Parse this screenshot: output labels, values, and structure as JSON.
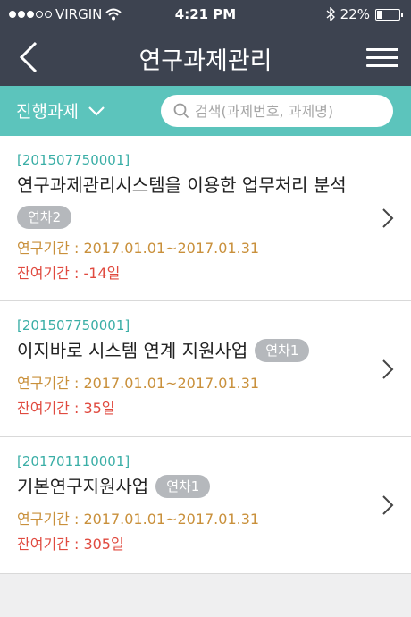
{
  "status_bar": {
    "carrier": "VIRGIN",
    "time": "4:21 PM",
    "battery_text": "22%",
    "battery_level": 0.22
  },
  "header": {
    "title": "연구과제관리"
  },
  "filter": {
    "selected": "진행과제",
    "search_placeholder": "검색(과제번호, 과제명)"
  },
  "items": [
    {
      "id": "[201507750001]",
      "title": "연구과제관리시스템을 이용한 업무처리 분석",
      "badge": "연차2",
      "period": "연구기간 : 2017.01.01~2017.01.31",
      "remaining": "잔여기간 : -14일"
    },
    {
      "id": "[201507750001]",
      "title": "이지바로 시스템 연계 지원사업",
      "badge": "연차1",
      "period": "연구기간 : 2017.01.01~2017.01.31",
      "remaining": "잔여기간 : 35일"
    },
    {
      "id": "[201701110001]",
      "title": "기본연구지원사업",
      "badge": "연차1",
      "period": "연구기간 : 2017.01.01~2017.01.31",
      "remaining": "잔여기간 : 305일"
    }
  ],
  "colors": {
    "header_bg": "#3d4350",
    "filter_bg": "#5cc4bc",
    "id_color": "#3aaea6",
    "period_color": "#c9903b",
    "remaining_color": "#e04a3f",
    "badge_bg": "#b5b8bc"
  },
  "icons": {
    "back": "chevron-left-icon",
    "menu": "hamburger-menu-icon",
    "dropdown": "chevron-down-icon",
    "search": "search-icon",
    "item_arrow": "chevron-right-icon"
  }
}
